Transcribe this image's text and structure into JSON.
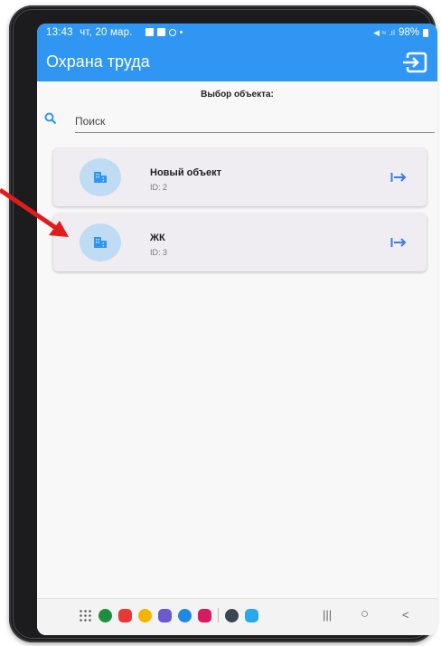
{
  "status_bar": {
    "time": "13:43",
    "date": "чт, 20 мар.",
    "battery": "98%"
  },
  "app_bar": {
    "title": "Охрана труда",
    "logout_icon": "logout-icon"
  },
  "content": {
    "section_title": "Выбор объекта:",
    "search": {
      "placeholder": "Поиск",
      "value": ""
    },
    "objects": [
      {
        "name": "Новый объект",
        "id_label": "ID: 2",
        "icon": "building-icon",
        "action_icon": "enter-arrow-icon"
      },
      {
        "name": "ЖК",
        "id_label": "ID: 3",
        "icon": "building-icon",
        "action_icon": "enter-arrow-icon"
      }
    ]
  },
  "nav_bar": {
    "dock_apps": [
      {
        "name": "apps-grid-icon",
        "color": "#555555"
      },
      {
        "name": "app-green-icon",
        "color": "#1e8e3e"
      },
      {
        "name": "app-red-icon",
        "color": "#e53935"
      },
      {
        "name": "app-yellow-icon",
        "color": "#f5b400"
      },
      {
        "name": "app-purple-icon",
        "color": "#6a5acd"
      },
      {
        "name": "app-chat-icon",
        "color": "#1e88e5"
      },
      {
        "name": "app-pink-icon",
        "color": "#d81b60"
      },
      {
        "name": "app-settings-icon",
        "color": "#37474f"
      },
      {
        "name": "app-telegram-icon",
        "color": "#29a9eb"
      }
    ],
    "recents": "|||",
    "home": "○",
    "back": "<"
  },
  "colors": {
    "primary": "#2f96f3",
    "accent": "#3d7de0",
    "card": "#efedf1",
    "avatar": "#bfdcf4",
    "annotation_arrow": "#e21b1b"
  }
}
